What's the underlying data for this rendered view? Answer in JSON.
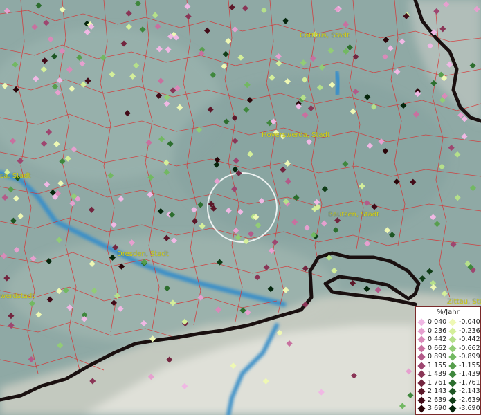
{
  "map": {
    "cities": [
      {
        "id": "cottbus",
        "label": "Cottbus, Stadt"
      },
      {
        "id": "hoyerswerda",
        "label": "Hoyerswerda, Stadt"
      },
      {
        "id": "riesa",
        "label": "sa, Stadt"
      },
      {
        "id": "bautzen",
        "label": "Bautzen, Stadt"
      },
      {
        "id": "dresden",
        "label": "Dresden, Stadt"
      },
      {
        "id": "hoyerswerda-left",
        "label": "werdstadt"
      },
      {
        "id": "zittau",
        "label": "Zittau, Sta"
      }
    ]
  },
  "legend": {
    "title": "%/Jahr",
    "positive": [
      "0.040",
      "0.236",
      "0.442",
      "0.662",
      "0.899",
      "1.155",
      "1.439",
      "1.761",
      "2.143",
      "2.639",
      "3.690"
    ],
    "negative": [
      "-0.040",
      "-0.236",
      "-0.442",
      "-0.662",
      "-0.899",
      "-1.155",
      "-1.439",
      "-1.761",
      "-2.143",
      "-2.639",
      "-3.690"
    ]
  },
  "colors": {
    "terrain": "#8fa9a5",
    "boundaries": "#d83030",
    "rivers": "#3a8fc8",
    "border_line": "#1a1010",
    "city_label": "#d6d21a",
    "pink_scale": [
      "#f0b8e4",
      "#e6a0cf",
      "#d98ab9",
      "#c8709f",
      "#b35a89",
      "#9e4670",
      "#8a3556",
      "#73253f",
      "#5c1729",
      "#430b18",
      "#2a0509"
    ],
    "green_scale": [
      "#eef8b4",
      "#d4ef9a",
      "#b5e08a",
      "#92cc76",
      "#72b862",
      "#579e4d",
      "#3f873d",
      "#2c6e2e",
      "#1d5623",
      "#103d17",
      "#05260c"
    ]
  }
}
